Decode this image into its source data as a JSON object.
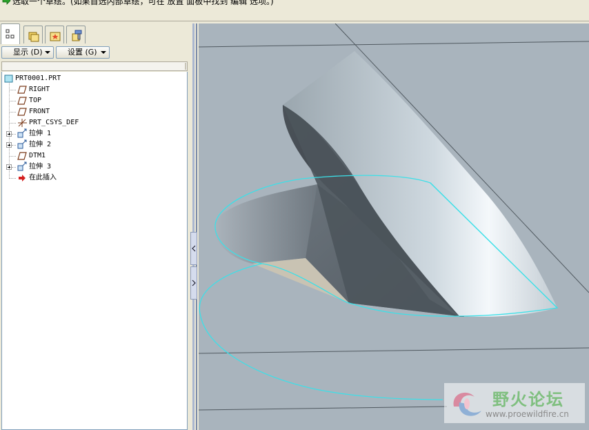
{
  "message_bar": {
    "text": "选取一个草绘。(如果首选内部草绘，可在 放置 面板中找到 编辑 选项。)"
  },
  "model_tree": {
    "tabs": [
      {
        "name": "model-tree",
        "icon": "tree-icon"
      },
      {
        "name": "folder-browser",
        "icon": "folder-icon"
      },
      {
        "name": "favorites",
        "icon": "favorites-icon"
      },
      {
        "name": "connections",
        "icon": "connections-icon"
      }
    ],
    "display_label": "显示 (D)",
    "settings_label": "设置 (G)",
    "items": [
      {
        "label": "PRT0001.PRT",
        "icon": "part-icon",
        "level": 0,
        "expandable": false
      },
      {
        "label": "RIGHT",
        "icon": "datum-plane-icon",
        "level": 1,
        "expandable": false
      },
      {
        "label": "TOP",
        "icon": "datum-plane-icon",
        "level": 1,
        "expandable": false
      },
      {
        "label": "FRONT",
        "icon": "datum-plane-icon",
        "level": 1,
        "expandable": false
      },
      {
        "label": "PRT_CSYS_DEF",
        "icon": "coordinate-system-icon",
        "level": 1,
        "expandable": false
      },
      {
        "label": "拉伸 1",
        "icon": "extrude-icon",
        "level": 1,
        "expandable": true
      },
      {
        "label": "拉伸 2",
        "icon": "extrude-icon",
        "level": 1,
        "expandable": true
      },
      {
        "label": "DTM1",
        "icon": "datum-plane-icon",
        "level": 1,
        "expandable": false
      },
      {
        "label": "拉伸 3",
        "icon": "extrude-icon",
        "level": 1,
        "expandable": true
      },
      {
        "label": "在此插入",
        "icon": "insert-here-icon",
        "level": 1,
        "expandable": false
      }
    ]
  },
  "watermark": {
    "title": "野火论坛",
    "url": "www.proewildfire.cn"
  },
  "colors": {
    "viewport_bg": "#a9b4bd",
    "highlight": "#3ce0e8",
    "tree_bg": "#ffffff"
  }
}
